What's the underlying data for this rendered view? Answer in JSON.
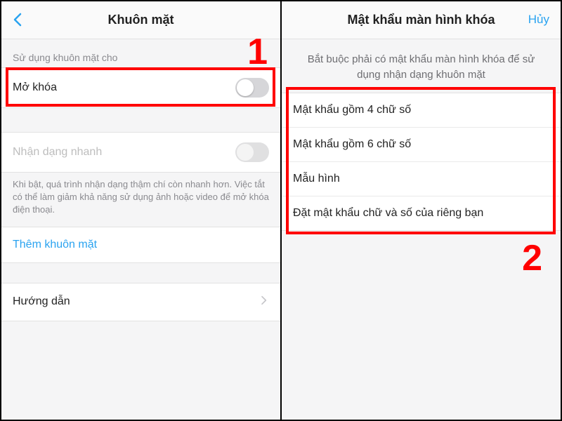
{
  "left": {
    "title": "Khuôn mặt",
    "section_label": "Sử dụng khuôn mặt cho",
    "unlock_label": "Mở khóa",
    "fast_recog_label": "Nhận dạng nhanh",
    "fast_recog_hint": "Khi bật, quá trình nhận dạng thậm chí còn nhanh hơn. Việc tắt có thể làm giảm khả năng sử dụng ảnh hoặc video để mở khóa điện thoại.",
    "add_face_label": "Thêm khuôn mặt",
    "guide_label": "Hướng dẫn"
  },
  "right": {
    "title": "Mật khẩu màn hình khóa",
    "cancel": "Hủy",
    "instruction": "Bắt buộc phải có mật khẩu màn hình khóa để sử dụng nhận dạng khuôn mặt",
    "opt_4digit": "Mật khẩu gồm 4 chữ số",
    "opt_6digit": "Mật khẩu gồm 6 chữ số",
    "opt_pattern": "Mẫu hình",
    "opt_custom": "Đặt mật khẩu chữ và số của riêng bạn"
  },
  "annotations": {
    "num1": "1",
    "num2": "2"
  }
}
